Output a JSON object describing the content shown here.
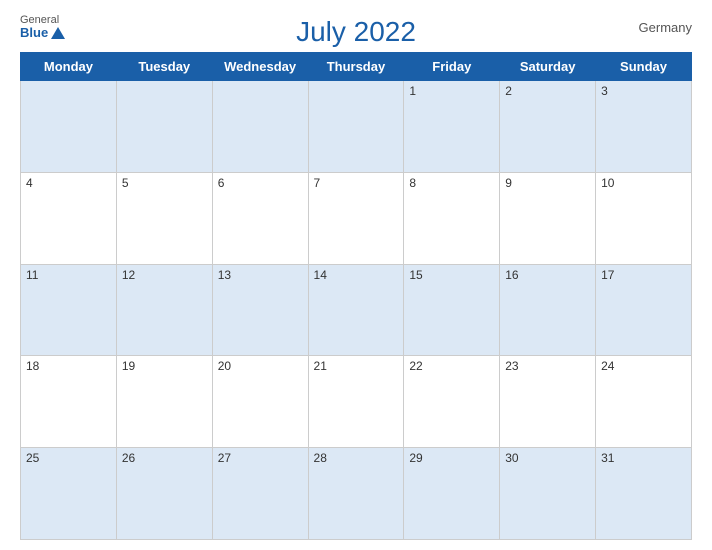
{
  "header": {
    "logo_general": "General",
    "logo_blue": "Blue",
    "title": "July 2022",
    "country": "Germany"
  },
  "days_of_week": [
    "Monday",
    "Tuesday",
    "Wednesday",
    "Thursday",
    "Friday",
    "Saturday",
    "Sunday"
  ],
  "weeks": [
    [
      "",
      "",
      "",
      "",
      "1",
      "2",
      "3"
    ],
    [
      "4",
      "5",
      "6",
      "7",
      "8",
      "9",
      "10"
    ],
    [
      "11",
      "12",
      "13",
      "14",
      "15",
      "16",
      "17"
    ],
    [
      "18",
      "19",
      "20",
      "21",
      "22",
      "23",
      "24"
    ],
    [
      "25",
      "26",
      "27",
      "28",
      "29",
      "30",
      "31"
    ]
  ]
}
